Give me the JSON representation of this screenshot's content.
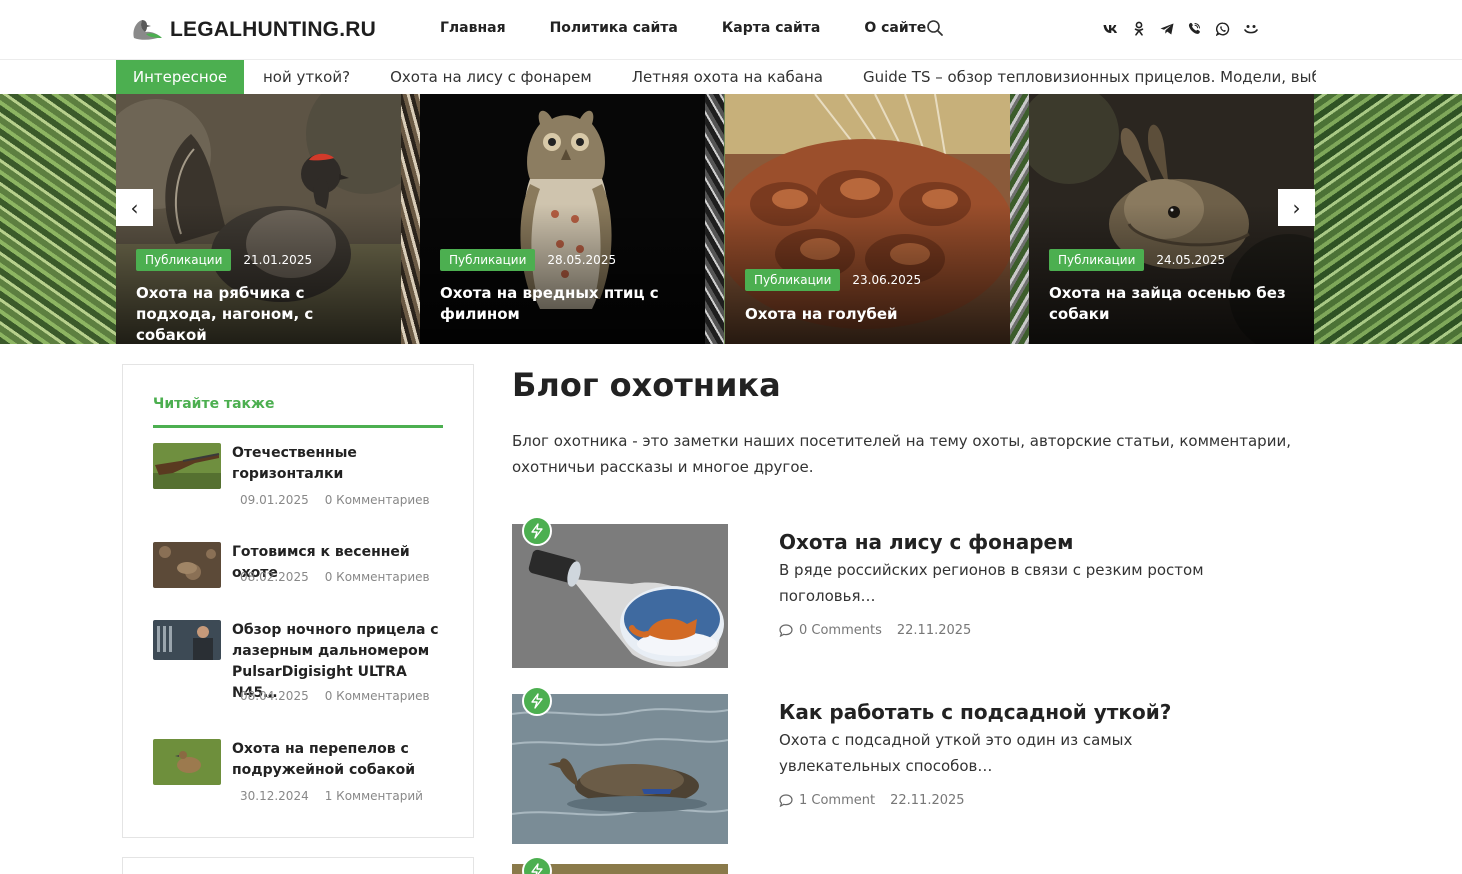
{
  "site": {
    "logo_text": "LEGALHUNTING.RU"
  },
  "nav": {
    "items": [
      "Главная",
      "Политика сайта",
      "Карта сайта",
      "О сайте"
    ]
  },
  "icons": {
    "search": "search-icon",
    "socials": [
      "vk-icon",
      "odnoklassniki-icon",
      "telegram-icon",
      "viber-icon",
      "whatsapp-icon",
      "moimir-icon"
    ]
  },
  "colors": {
    "accent": "#4caf50",
    "text": "#222222",
    "muted": "#888888"
  },
  "ticker": {
    "label": "Интересное",
    "items": [
      "ной уткой?",
      "Охота на лису с фонарем",
      "Летняя охота на кабана",
      "Guide TS – обзор тепловизионных прицелов. Модели, выбор, реко"
    ]
  },
  "slider": {
    "slides": [
      {
        "tag": "Публикации",
        "date": "21.01.2025",
        "title": "Охота на рябчика с подхода, нагоном, с собакой"
      },
      {
        "tag": "Публикации",
        "date": "28.05.2025",
        "title": "Охота на вредных птиц с филином"
      },
      {
        "tag": "Публикации",
        "date": "23.06.2025",
        "title": "Охота на голубей"
      },
      {
        "tag": "Публикации",
        "date": "24.05.2025",
        "title": "Охота на зайца осенью без собаки"
      }
    ],
    "prev": "‹",
    "next": "›"
  },
  "sidebar": {
    "title": "Читайте также",
    "items": [
      {
        "title": "Отечественные горизонталки",
        "date": "09.01.2025",
        "comments": "0 Комментариев"
      },
      {
        "title": "Готовимся к весенней охоте",
        "date": "08.02.2025",
        "comments": "0 Комментариев"
      },
      {
        "title": "Обзор ночного прицела с лазерным дальномером PulsarDigisight ULTRA N45…",
        "date": "08.04.2025",
        "comments": "0 Комментариев"
      },
      {
        "title": "Охота на перепелов с подружейной собакой",
        "date": "30.12.2024",
        "comments": "1 Комментарий"
      }
    ]
  },
  "main": {
    "title": "Блог охотника",
    "description": "Блог охотника - это заметки наших посетителей на тему охоты, авторские статьи, комментарии, охотничьи рассказы и многое другое.",
    "posts": [
      {
        "title": "Охота на лису с фонарем",
        "excerpt": "В ряде российских регионов в связи с резким ростом поголовья…",
        "comments": "0 Comments",
        "date": "22.11.2025"
      },
      {
        "title": "Как работать с подсадной уткой?",
        "excerpt": "Охота с подсадной уткой это один из самых увлекательных способов…",
        "comments": "1 Comment",
        "date": "22.11.2025"
      }
    ]
  }
}
